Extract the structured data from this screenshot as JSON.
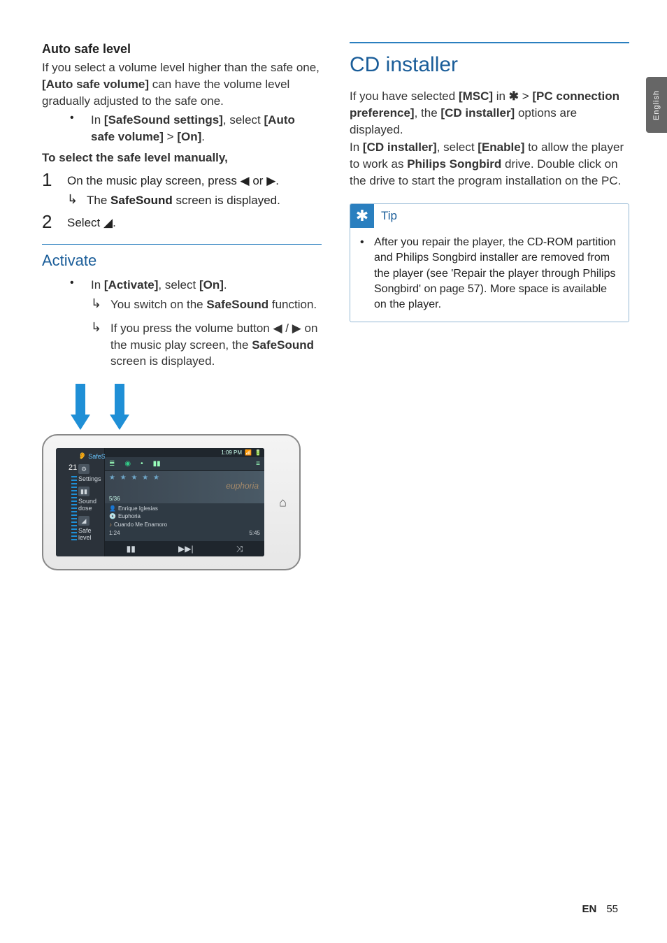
{
  "language_tab": "English",
  "left": {
    "auto_safe_heading": "Auto safe level",
    "auto_para_1a": "If you select a volume level higher than the safe one, ",
    "auto_para_1b": "[Auto safe volume]",
    "auto_para_1c": " can have the volume level gradually adjusted to the safe one.",
    "bullet_in": "In ",
    "bullet_safesound": "[SafeSound settings]",
    "bullet_select": ", select ",
    "bullet_autosafe": "[Auto safe volume]",
    "bullet_gt": " > ",
    "bullet_on": "[On]",
    "bullet_period": ".",
    "manual_heading": "To select the safe level manually,",
    "step1_a": "On the music play screen, press ",
    "step1_b": " or ",
    "step1_c": ".",
    "step1_sub_a": "The ",
    "step1_sub_b": "SafeSound",
    "step1_sub_c": " screen is displayed.",
    "step2": "Select ",
    "activate_heading": "Activate",
    "act_bullet_in": "In ",
    "act_bullet_activate": "[Activate]",
    "act_bullet_select": ", select ",
    "act_bullet_on": "[On]",
    "act_bullet_period": ".",
    "act_sub1_a": "You switch on the ",
    "act_sub1_b": "SafeSound",
    "act_sub1_c": " function.",
    "act_sub2_a": "If you press the volume button ",
    "act_sub2_b": " / ",
    "act_sub2_c": " on the music play screen, the ",
    "act_sub2_d": "SafeSound",
    "act_sub2_e": " screen is displayed."
  },
  "device": {
    "volume": "21",
    "safesound": "SafeSound",
    "menu_settings": "Settings",
    "menu_sounddose": "Sound dose",
    "menu_safelevel": "Safe level",
    "time": "1:09 PM",
    "track_count": "5/36",
    "album_title": "euphoria",
    "artist": "Enrique Iglesias",
    "track1": "Euphoria",
    "track2": "Cuando Me Enamoro",
    "elapsed": "1:24",
    "duration": "5:45"
  },
  "right": {
    "cd_heading": "CD installer",
    "p1_a": "If you have selected ",
    "p1_b": "[MSC]",
    "p1_c": " in ",
    "p1_d": " > ",
    "p1_e": "[PC connection preference]",
    "p1_f": ", the ",
    "p1_g": "[CD installer]",
    "p1_h": " options are displayed.",
    "p2_a": "In ",
    "p2_b": "[CD installer]",
    "p2_c": ", select ",
    "p2_d": "[Enable]",
    "p2_e": " to allow the player to work as ",
    "p2_f": "Philips Songbird",
    "p2_g": " drive. Double click on the drive to start the program installation on the PC.",
    "tip_label": "Tip",
    "tip_text": "After you repair the player, the CD-ROM partition and Philips Songbird installer are removed from the player (see 'Repair the player through Philips Songbird' on page 57). More space is available on the player."
  },
  "footer": {
    "en": "EN",
    "page": "55"
  }
}
